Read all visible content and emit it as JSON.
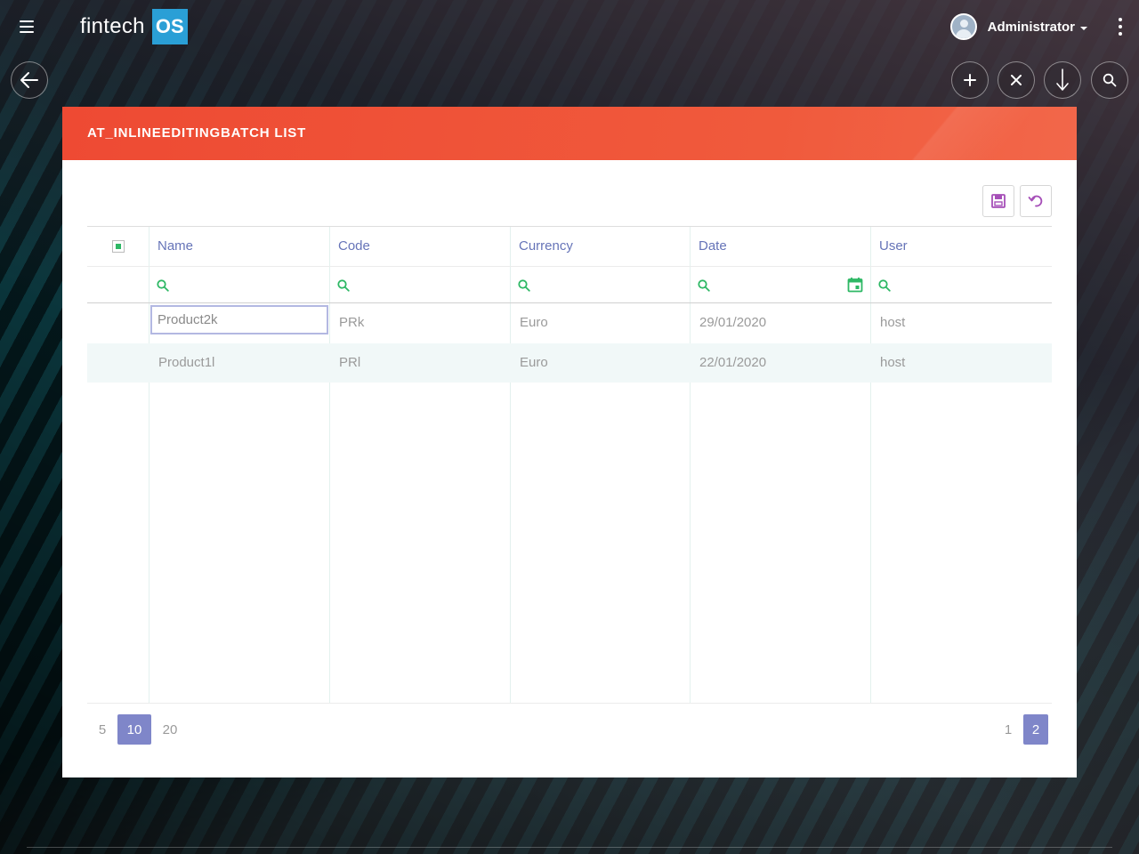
{
  "app": {
    "brand_text": "fintech",
    "brand_badge": "OS"
  },
  "user": {
    "name": "Administrator"
  },
  "actions": {
    "back": "back-arrow-icon",
    "add": "plus-icon",
    "close": "close-icon",
    "sort": "arrow-down-icon",
    "search": "search-icon"
  },
  "card": {
    "title": "AT_INLINEEDITINGBATCH LIST"
  },
  "toolbar": {
    "save_icon": "save-icon",
    "undo_icon": "undo-icon"
  },
  "grid": {
    "columns": [
      "Name",
      "Code",
      "Currency",
      "Date",
      "User"
    ],
    "filters": [
      "",
      "",
      "",
      "",
      ""
    ],
    "rows": [
      {
        "name": "Product2k",
        "code": "PRk",
        "currency": "Euro",
        "date": "29/01/2020",
        "user": "host",
        "editing": true
      },
      {
        "name": "Product1l",
        "code": "PRl",
        "currency": "Euro",
        "date": "22/01/2020",
        "user": "host",
        "editing": false
      }
    ]
  },
  "pagination": {
    "page_sizes": [
      "5",
      "10",
      "20"
    ],
    "selected_page_size": "10",
    "pages": [
      "1",
      "2"
    ],
    "current_page": "2"
  },
  "colors": {
    "header_accent": "#ee4a33",
    "column_header_text": "#6674b8",
    "pager_active": "#7f86c9",
    "filter_icon": "#2eb865",
    "tool_icon": "#a64fb8",
    "brand_badge": "#2a9fd6"
  }
}
